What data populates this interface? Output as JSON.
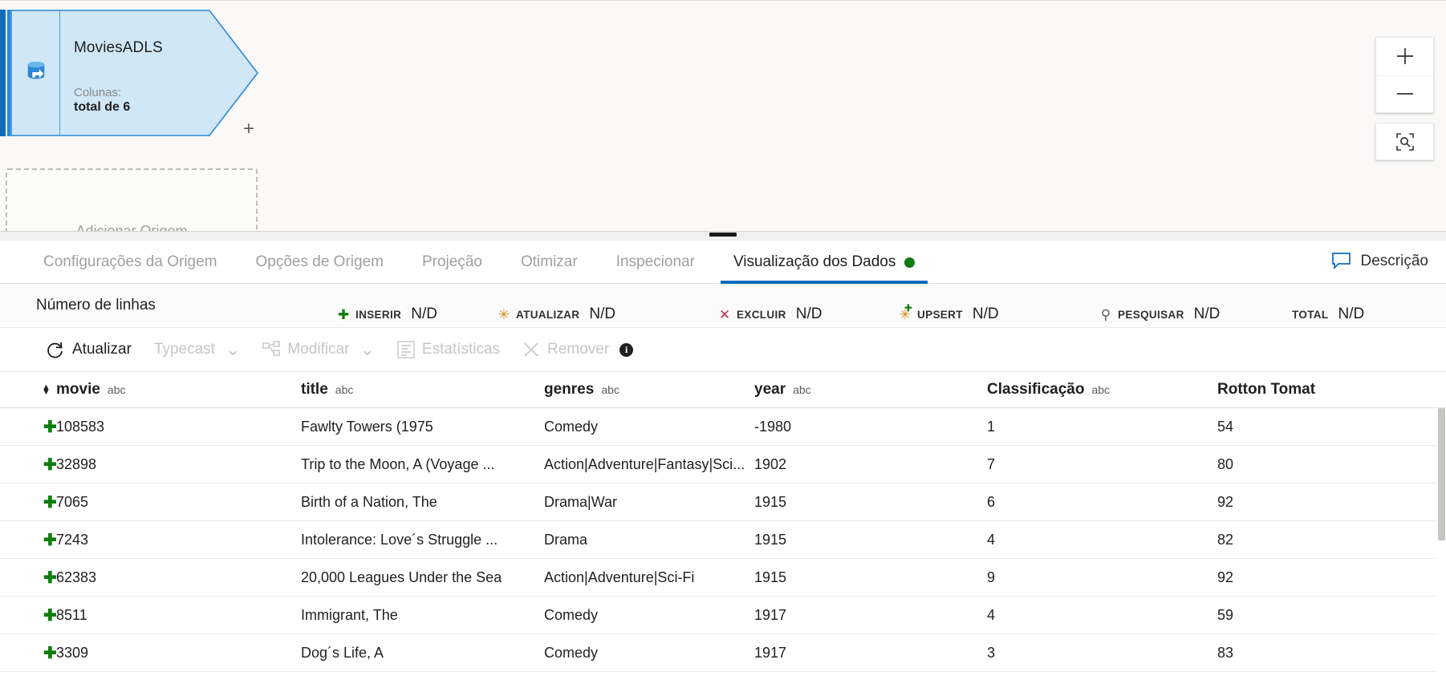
{
  "canvas": {
    "node": {
      "title": "MoviesADLS",
      "sub_label": "Colunas:",
      "sub_value": "total de 6",
      "plus": "+",
      "icon": "source-dataset-icon"
    },
    "add_source": {
      "label": "Adicionar Origem"
    },
    "zoom_controls": {
      "zoom_in": "+",
      "zoom_out": "—",
      "fit": "fit-to-screen"
    }
  },
  "panel": {
    "tabs": [
      {
        "label": "Configurações da Origem",
        "active": false,
        "dot": false
      },
      {
        "label": "Opções de Origem",
        "active": false,
        "dot": false
      },
      {
        "label": "Projeção",
        "active": false,
        "dot": false
      },
      {
        "label": "Otimizar",
        "active": false,
        "dot": false
      },
      {
        "label": "Inspecionar",
        "active": false,
        "dot": false
      },
      {
        "label": "Visualização dos Dados",
        "active": true,
        "dot": true
      }
    ],
    "description_button": "Descrição",
    "stats": {
      "title": "Número de linhas",
      "items": [
        {
          "label": "INSERIR",
          "value": "N/D",
          "icon": "plus-icon",
          "color": "#107c10"
        },
        {
          "label": "ATUALIZAR",
          "value": "N/D",
          "icon": "asterisk-icon",
          "color": "#d18b14"
        },
        {
          "label": "EXCLUIR",
          "value": "N/D",
          "icon": "cross-icon",
          "color": "#c4314b"
        },
        {
          "label": "UPSERT",
          "value": "N/D",
          "icon": "upsert-icon",
          "color": "#107c10"
        },
        {
          "label": "PESQUISAR",
          "value": "N/D",
          "icon": "search-icon",
          "color": "#605e5c"
        },
        {
          "label": "TOTAL",
          "value": "N/D",
          "icon": "none",
          "color": "#201f1e"
        }
      ]
    },
    "toolbar": [
      {
        "label": "Atualizar",
        "enabled": true,
        "icon": "refresh-icon",
        "chevron": false
      },
      {
        "label": "Typecast",
        "enabled": false,
        "icon": "none",
        "chevron": true
      },
      {
        "label": "Modificar",
        "enabled": false,
        "icon": "modify-icon",
        "chevron": true
      },
      {
        "label": "Estatísticas",
        "enabled": false,
        "icon": "statistics-icon",
        "chevron": false
      },
      {
        "label": "Remover",
        "enabled": false,
        "icon": "close-icon",
        "chevron": false
      }
    ],
    "toolbar_info": "i"
  },
  "table": {
    "columns": [
      {
        "name": "movie",
        "type": "abc"
      },
      {
        "name": "title",
        "type": "abc"
      },
      {
        "name": "genres",
        "type": "abc"
      },
      {
        "name": "year",
        "type": "abc"
      },
      {
        "name": "Classificação",
        "type": "abc"
      },
      {
        "name": "Rotton Tomat",
        "type": ""
      }
    ],
    "rows": [
      {
        "movie": "108583",
        "title": "Fawlty Towers (1975",
        "genres": "Comedy",
        "year": "-1980",
        "classificacao": "1",
        "rotton": "54"
      },
      {
        "movie": "32898",
        "title": "Trip to the Moon, A (Voyage ...",
        "genres": "Action|Adventure|Fantasy|Sci...",
        "year": "1902",
        "classificacao": "7",
        "rotton": "80"
      },
      {
        "movie": "7065",
        "title": "Birth of a Nation, The",
        "genres": "Drama|War",
        "year": "1915",
        "classificacao": "6",
        "rotton": "92"
      },
      {
        "movie": "7243",
        "title": "Intolerance: Love´s Struggle ...",
        "genres": "Drama",
        "year": "1915",
        "classificacao": "4",
        "rotton": "82"
      },
      {
        "movie": "62383",
        "title": "20,000 Leagues Under the Sea",
        "genres": "Action|Adventure|Sci-Fi",
        "year": "1915",
        "classificacao": "9",
        "rotton": "92"
      },
      {
        "movie": "8511",
        "title": "Immigrant, The",
        "genres": "Comedy",
        "year": "1917",
        "classificacao": "4",
        "rotton": "59"
      },
      {
        "movie": "3309",
        "title": "Dog´s Life, A",
        "genres": "Comedy",
        "year": "1917",
        "classificacao": "3",
        "rotton": "83"
      }
    ]
  },
  "colors": {
    "accent": "#0f6cbd",
    "node_fill": "#cfe7f7",
    "node_border": "#2b88d8",
    "status_green": "#107c10"
  }
}
